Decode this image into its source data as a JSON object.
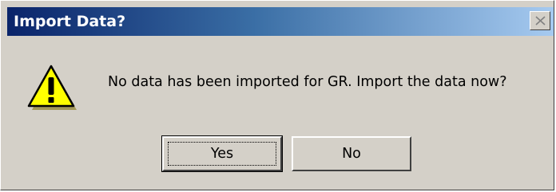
{
  "dialog": {
    "title": "Import Data?",
    "message": "No data has been imported for GR. Import the data now?",
    "icon": "warning-icon",
    "buttons": {
      "yes_label": "Yes",
      "no_label": "No"
    },
    "close_icon": "close-icon"
  },
  "colors": {
    "titlebar_start": "#0a246a",
    "titlebar_end": "#a6caf0",
    "face": "#d4d0c8",
    "warning_fill": "#ffff00"
  }
}
